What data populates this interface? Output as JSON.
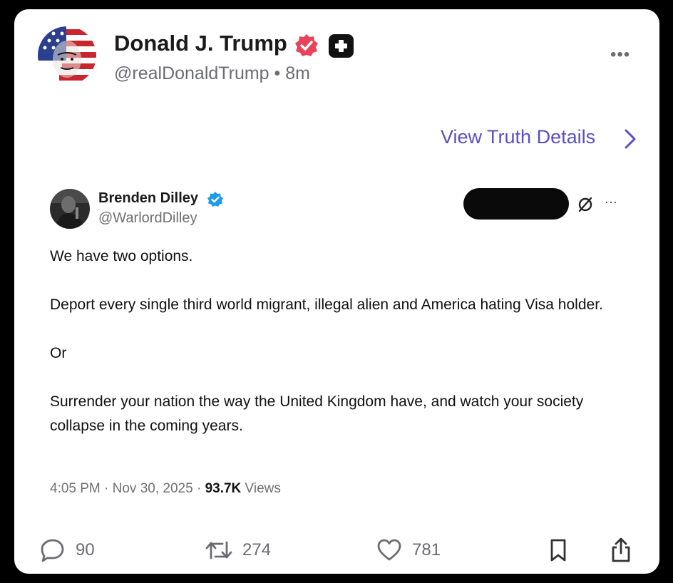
{
  "post": {
    "author_name": "Donald J. Trump",
    "author_handle": "@realDonaldTrump",
    "separator": "•",
    "time_ago": "8m",
    "more_label": "•••",
    "view_details_label": "View Truth Details"
  },
  "quoted_post": {
    "author_name": "Brenden Dilley",
    "author_handle": "@WarlordDilley",
    "more_label": "···",
    "paragraphs": [
      "We have two options.",
      "Deport every single third world migrant, illegal alien and America hating Visa holder.",
      "Or",
      "Surrender your nation the way the United Kingdom have, and watch your society collapse in the coming years."
    ],
    "timestamp": "4:05 PM · Nov 30, 2025 · ",
    "views_count": "93.7K",
    "views_label": " Views"
  },
  "actions": {
    "replies": "90",
    "reposts": "274",
    "likes": "781"
  },
  "colors": {
    "link": "#5a4fc4",
    "verified_main": "#e8435a",
    "verified_quote": "#1d9bf0",
    "muted": "#6b6b73"
  },
  "icons": {
    "reply": "speech-bubble-icon",
    "repost": "repost-arrows-icon",
    "like": "heart-icon",
    "bookmark": "bookmark-icon",
    "share": "share-icon"
  }
}
